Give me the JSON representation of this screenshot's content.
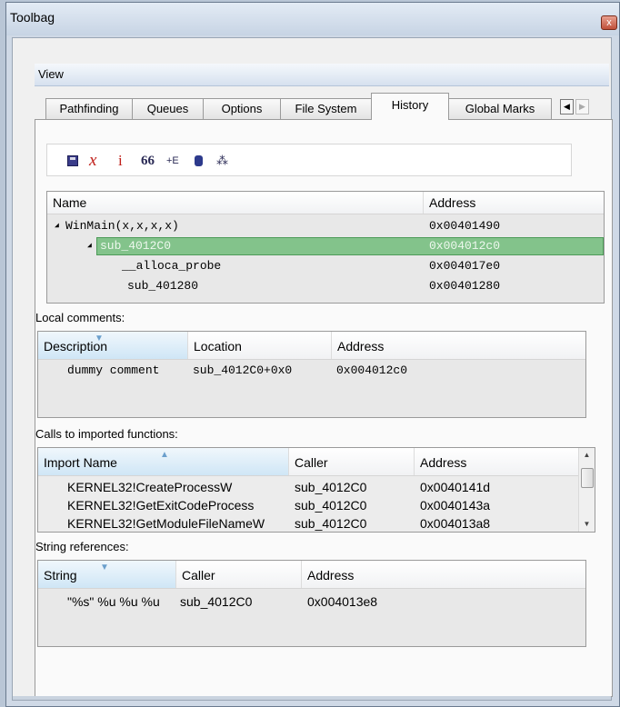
{
  "window": {
    "title": "Toolbag",
    "close_label": "x"
  },
  "view_menu": {
    "label": "View"
  },
  "tabs": [
    {
      "label": "Pathfinding",
      "active": false
    },
    {
      "label": "Queues",
      "active": false
    },
    {
      "label": "Options",
      "active": false
    },
    {
      "label": "File System",
      "active": false
    },
    {
      "label": "History",
      "active": true
    },
    {
      "label": "Global Marks",
      "active": false
    }
  ],
  "tab_scroll": {
    "left": "◀",
    "right": "▶"
  },
  "toolbar": {
    "icons": [
      {
        "name": "save-icon",
        "glyph": ""
      },
      {
        "name": "delete-icon",
        "glyph": "x",
        "color": "#c0201a"
      },
      {
        "name": "info-icon",
        "glyph": "i",
        "color": "#c0201a"
      },
      {
        "name": "quote-icon",
        "glyph": "66",
        "color": "#2a2a55"
      },
      {
        "name": "add-edge-icon",
        "glyph": "+E",
        "color": "#2a2a55"
      },
      {
        "name": "database-icon",
        "glyph": ""
      },
      {
        "name": "graph-icon",
        "glyph": "⁂",
        "color": "#2a2a55"
      }
    ]
  },
  "history_tree": {
    "columns": {
      "name": "Name",
      "address": "Address"
    },
    "rows": [
      {
        "indent": 0,
        "expander": "◢",
        "name": "WinMain(x,x,x,x)",
        "address": "0x00401490",
        "selected": false
      },
      {
        "indent": 1,
        "expander": "◢",
        "name": "sub_4012C0",
        "address": "0x004012c0",
        "selected": true
      },
      {
        "indent": 3,
        "expander": "",
        "name": "__alloca_probe",
        "address": "0x004017e0",
        "selected": false
      },
      {
        "indent": 2,
        "expander": "",
        "name": "sub_401280",
        "address": "0x00401280",
        "selected": false
      }
    ]
  },
  "local_comments": {
    "label": "Local comments:",
    "columns": {
      "description": "Description",
      "location": "Location",
      "address": "Address"
    },
    "rows": [
      {
        "description": "dummy comment",
        "location": "sub_4012C0+0x0",
        "address": "0x004012c0"
      }
    ]
  },
  "imported_calls": {
    "label": "Calls to imported functions:",
    "columns": {
      "import_name": "Import Name",
      "caller": "Caller",
      "address": "Address"
    },
    "rows": [
      {
        "import_name": "KERNEL32!CreateProcessW",
        "caller": "sub_4012C0",
        "address": "0x0040141d"
      },
      {
        "import_name": "KERNEL32!GetExitCodeProcess",
        "caller": "sub_4012C0",
        "address": "0x0040143a"
      },
      {
        "import_name": "KERNEL32!GetModuleFileNameW",
        "caller": "sub_4012C0",
        "address": "0x004013a8"
      }
    ]
  },
  "string_refs": {
    "label": "String references:",
    "columns": {
      "string": "String",
      "caller": "Caller",
      "address": "Address"
    },
    "rows": [
      {
        "string": "\"%s\" %u %u %u",
        "caller": "sub_4012C0",
        "address": "0x004013e8"
      }
    ]
  },
  "colors": {
    "selection_green": "#83c38b",
    "accent_red": "#c0201a"
  }
}
